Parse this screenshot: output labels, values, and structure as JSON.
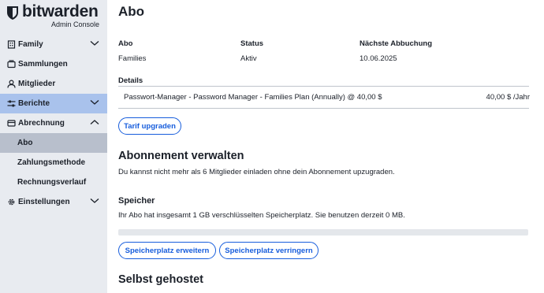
{
  "app": {
    "brand": "bitwarden",
    "subtitle": "Admin Console"
  },
  "sidebar": {
    "items": [
      {
        "label": "Family",
        "icon": "building-icon"
      },
      {
        "label": "Sammlungen",
        "icon": "collection-icon"
      },
      {
        "label": "Mitglieder",
        "icon": "user-icon"
      },
      {
        "label": "Berichte",
        "icon": "sliders-icon"
      },
      {
        "label": "Abrechnung",
        "icon": "billing-icon"
      },
      {
        "label": "Abo"
      },
      {
        "label": "Zahlungsmethode"
      },
      {
        "label": "Rechnungsverlauf"
      },
      {
        "label": "Einstellungen",
        "icon": "gear-icon"
      }
    ]
  },
  "page": {
    "title": "Abo",
    "summary": {
      "headers": [
        "Abo",
        "Status",
        "Nächste Abbuchung"
      ],
      "values": [
        "Families",
        "Aktiv",
        "10.06.2025"
      ]
    },
    "details_label": "Details",
    "details_row": {
      "item": "Passwort-Manager - Password Manager - Families Plan (Annually) @ 40,00 $",
      "price": "40,00 $ /Jahr"
    },
    "upgrade_button": "Tarif upgraden",
    "manage": {
      "title": "Abonnement verwalten",
      "text": "Du kannst nicht mehr als 6 Mitglieder einladen ohne dein Abonnement upzugraden."
    },
    "storage": {
      "title": "Speicher",
      "text": "Ihr Abo hat insgesamt 1 GB verschlüsselten Speicherplatz. Sie benutzen derzeit 0 MB.",
      "used_fraction": 0,
      "add_button": "Speicherplatz erweitern",
      "remove_button": "Speicherplatz verringern"
    },
    "self_hosted_title": "Selbst gehostet"
  },
  "colors": {
    "accent": "#175ddc",
    "sidebar_bg": "#e8ebf0",
    "active_parent": "#a9c2ec",
    "active_child": "#b8bfcc"
  }
}
